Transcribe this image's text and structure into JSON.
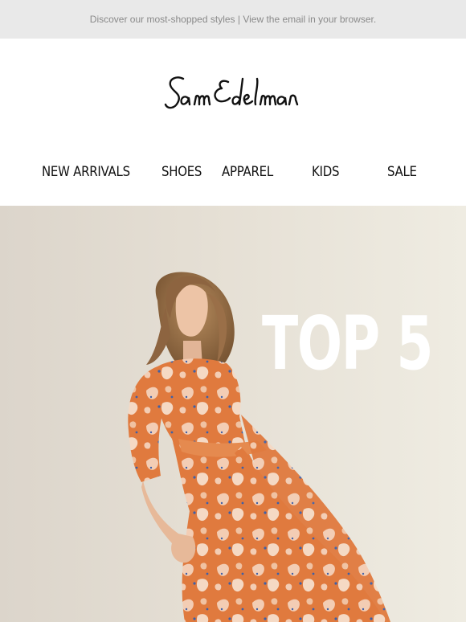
{
  "preheader": {
    "text": "Discover our most-shopped styles | View the email in your browser."
  },
  "brand": {
    "name": "Sam Edelman"
  },
  "nav": {
    "items": [
      {
        "label": "NEW ARRIVALS"
      },
      {
        "label": "SHOES"
      },
      {
        "label": "APPAREL"
      },
      {
        "label": "KIDS"
      },
      {
        "label": "SALE"
      }
    ]
  },
  "hero": {
    "headline": "TOP 5",
    "image": "woman-in-orange-floral-dress"
  },
  "colors": {
    "preheader_bg": "#e9e9e9",
    "preheader_text": "#8a8a8a",
    "nav_text": "#111111",
    "hero_bg": "#e5dfd4",
    "headline": "#ffffff",
    "dress_orange": "#e07a3e"
  }
}
